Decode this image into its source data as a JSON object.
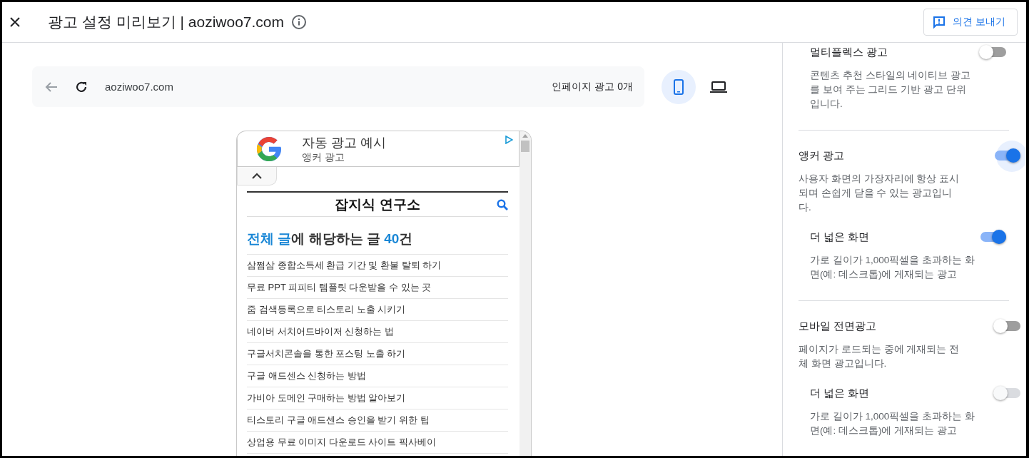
{
  "header": {
    "title": "광고 설정 미리보기 | aoziwoo7.com",
    "feedback_button": "의견 보내기"
  },
  "toolbar": {
    "url": "aoziwoo7.com",
    "ad_count": "인페이지 광고 0개",
    "devices": [
      {
        "kind": "mobile",
        "selected": true
      },
      {
        "kind": "desktop",
        "selected": false
      }
    ]
  },
  "preview": {
    "ad_banner": {
      "title": "자동 광고 예시",
      "subtitle": "앵커 광고"
    },
    "blog_title": "잡지식 연구소",
    "heading": [
      {
        "text": "전체 글",
        "accent": true
      },
      {
        "text": "에 해당하는 글 ",
        "accent": false
      },
      {
        "text": "40",
        "accent": true
      },
      {
        "text": "건",
        "accent": false
      }
    ],
    "posts": [
      "삼쩜삼 종합소득세 환급 기간 및 환불 탈퇴 하기",
      "무료 PPT 피피티 템플릿 다운받을 수 있는 곳",
      "줌 검색등록으로 티스토리 노출 시키기",
      "네이버 서치어드바이저 신청하는 법",
      "구글서치콘솔을 통한 포스팅 노출 하기",
      "구글 애드센스 신청하는 방법",
      "가비아 도메인 구매하는 방법 알아보기",
      "티스토리 구글 애드센스 승인을 받기 위한 팁",
      "상업용 무료 이미지 다운로드 사이트 픽사베이"
    ]
  },
  "settings": [
    {
      "kind": "sub",
      "title": "멀티플렉스 광고",
      "description": "콘텐츠 추천 스타일의 네이티브 광고를 보여 주는 그리드 기반 광고 단위입니다.",
      "on": false,
      "disabled": false,
      "focused": false,
      "divider": true
    },
    {
      "kind": "main",
      "title": "앵커 광고",
      "description": "사용자 화면의 가장자리에 항상 표시되며 손쉽게 닫을 수 있는 광고입니다.",
      "on": true,
      "disabled": false,
      "focused": true,
      "divider": false
    },
    {
      "kind": "sub",
      "title": "더 넓은 화면",
      "description": "가로 길이가 1,000픽셀을 초과하는 화면(예: 데스크톱)에 게재되는 광고",
      "on": true,
      "disabled": false,
      "focused": false,
      "divider": true
    },
    {
      "kind": "main",
      "title": "모바일 전면광고",
      "description": "페이지가 로드되는 중에 게재되는 전체 화면 광고입니다.",
      "on": false,
      "disabled": false,
      "focused": false,
      "divider": false
    },
    {
      "kind": "sub",
      "title": "더 넓은 화면",
      "description": "가로 길이가 1,000픽셀을 초과하는 화면(예: 데스크톱)에 게재되는 광고",
      "on": false,
      "disabled": true,
      "focused": false,
      "divider": false
    }
  ]
}
